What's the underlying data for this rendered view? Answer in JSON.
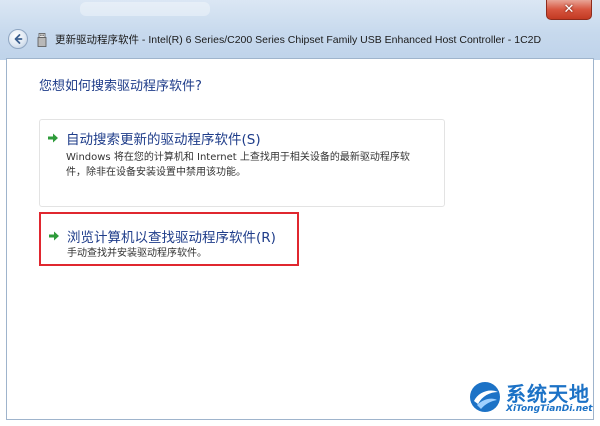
{
  "window": {
    "title": "更新驱动程序软件 - Intel(R) 6 Series/C200 Series Chipset Family USB Enhanced Host Controller - 1C2D",
    "close_label": "✕"
  },
  "content": {
    "question": "您想如何搜索驱动程序软件?",
    "options": [
      {
        "title": "自动搜索更新的驱动程序软件(S)",
        "desc_line1": "Windows 将在您的计算机和 Internet 上查找用于相关设备的最新驱动程序软",
        "desc_line2": "件，除非在设备安装设置中禁用该功能。"
      },
      {
        "title": "浏览计算机以查找驱动程序软件(R)",
        "desc_line1": "手动查找并安装驱动程序软件。"
      }
    ]
  },
  "watermark": {
    "brand": "系统天地",
    "url": "XiTongTianDi.net"
  },
  "colors": {
    "accent_link": "#1f3d8a",
    "highlight_border": "#e0272f",
    "arrow_green": "#2e9b3a"
  }
}
